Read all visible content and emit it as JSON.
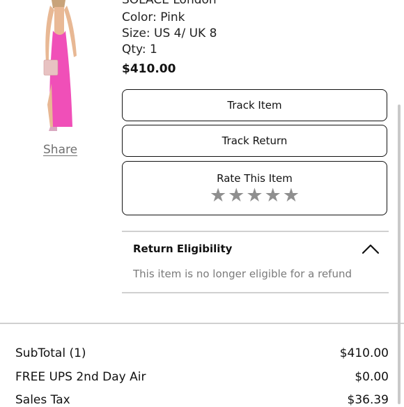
{
  "product": {
    "brand_partial": "SOLACE London",
    "color": "Color: Pink",
    "size": "Size: US 4/ UK 8",
    "qty": "Qty: 1",
    "price": "$410.00",
    "share_label": "Share",
    "image_color": "#f04fb8"
  },
  "actions": {
    "track_item": "Track Item",
    "track_return": "Track Return",
    "rate_item": "Rate This Item",
    "rating_stars": 0,
    "max_stars": 5
  },
  "eligibility": {
    "title": "Return Eligibility",
    "message": "This item is no longer eligible for a refund",
    "expanded": true
  },
  "summary": {
    "rows": [
      {
        "label": "SubTotal (1)",
        "value": "$410.00"
      },
      {
        "label": "FREE UPS 2nd Day Air",
        "value": "$0.00"
      },
      {
        "label": "Sales Tax",
        "value": "$36.39"
      }
    ]
  }
}
